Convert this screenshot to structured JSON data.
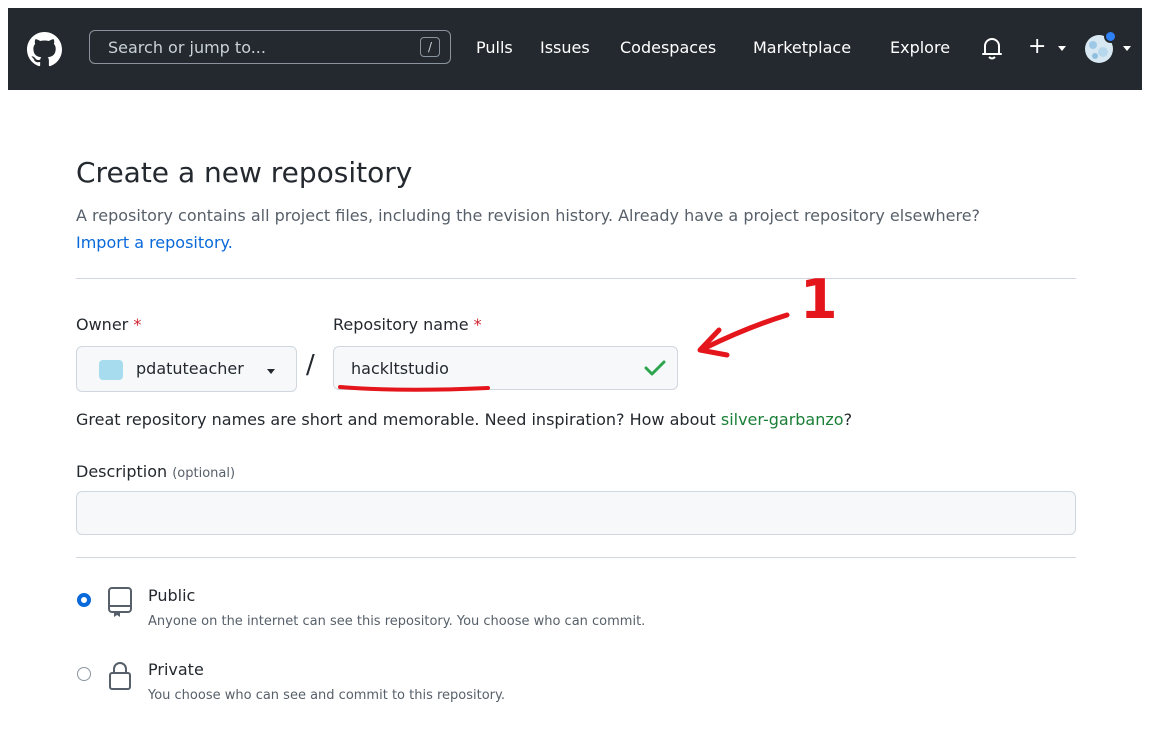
{
  "header": {
    "search_placeholder": "Search or jump to...",
    "search_shortcut": "/",
    "nav": [
      "Pulls",
      "Issues",
      "Codespaces",
      "Marketplace",
      "Explore"
    ],
    "plus": "+"
  },
  "page": {
    "title": "Create a new repository",
    "lead": "A repository contains all project files, including the revision history. Already have a project repository elsewhere?",
    "import_link": "Import a repository."
  },
  "form": {
    "owner_label": "Owner",
    "required_mark": "*",
    "owner_value": "pdatuteacher",
    "separator": "/",
    "repo_label": "Repository name",
    "repo_value": "hackltstudio",
    "hint_text": "Great repository names are short and memorable. Need inspiration? How about",
    "hint_suggestion": "silver-garbanzo",
    "hint_end": "?",
    "description_label": "Description",
    "description_optional": "(optional)",
    "description_value": ""
  },
  "visibility": {
    "public_title": "Public",
    "public_desc": "Anyone on the internet can see this repository. You choose who can commit.",
    "private_title": "Private",
    "private_desc": "You choose who can see and commit to this repository.",
    "selected": "public"
  },
  "annotation": {
    "number": "1",
    "color": "#e5151c"
  },
  "colors": {
    "header_bg": "#24292f",
    "link": "#0969da",
    "suggestion": "#1a7f37",
    "required": "#cf222e"
  }
}
